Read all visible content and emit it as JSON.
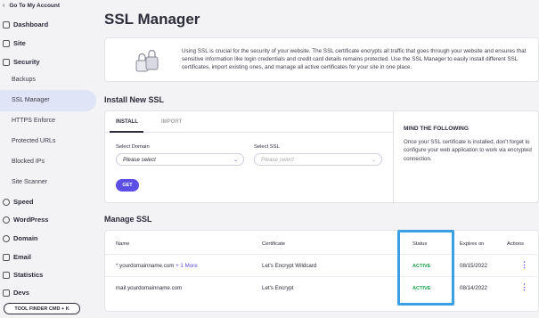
{
  "sidebar": {
    "goto": "Go To My Account",
    "items": [
      {
        "label": "Dashboard",
        "icon": "grid-icon"
      },
      {
        "label": "Site",
        "icon": "site-icon"
      },
      {
        "label": "Security",
        "icon": "lock-icon"
      },
      {
        "label": "Speed",
        "icon": "speed-icon"
      },
      {
        "label": "WordPress",
        "icon": "wordpress-icon"
      },
      {
        "label": "Domain",
        "icon": "globe-icon"
      },
      {
        "label": "Email",
        "icon": "email-icon"
      },
      {
        "label": "Statistics",
        "icon": "chart-icon"
      },
      {
        "label": "Devs",
        "icon": "code-icon"
      }
    ],
    "security_sub": [
      "Backups",
      "SSL Manager",
      "HTTPS Enforce",
      "Protected URLs",
      "Blocked IPs",
      "Site Scanner"
    ],
    "tool_finder": "TOOL FINDER CMD + K"
  },
  "page": {
    "title": "SSL Manager",
    "intro": "Using SSL is crucial for the security of your website. The SSL certificate encrypts all traffic that goes through your website and ensures that sensitive information like login credentials and credit card details remains protected. Use the SSL Manager to easily install different SSL certificates, import existing ones, and manage all active certificates for your site in one place."
  },
  "install": {
    "title": "Install New SSL",
    "tabs": [
      "INSTALL",
      "IMPORT"
    ],
    "domain_label": "Select Domain",
    "domain_value": "Please select",
    "ssl_label": "Select SSL",
    "ssl_value": "Please select",
    "get_button": "GET",
    "mind_title": "MIND THE FOLLOWING",
    "mind_text": "Once your SSL certificate is installed, don't forget to configure your web application to work via encrypted connection."
  },
  "manage": {
    "title": "Manage SSL",
    "headers": [
      "Name",
      "Certificate",
      "Status",
      "Expires on",
      "Actions"
    ],
    "rows": [
      {
        "name": "*.yourdomainname.com",
        "more": "+ 1 More",
        "certificate": "Let's Encrypt Wildcard",
        "status": "ACTIVE",
        "expires": "08/15/2022"
      },
      {
        "name": "mail.yourdomainname.com",
        "more": "",
        "certificate": "Let's Encrypt",
        "status": "ACTIVE",
        "expires": "08/14/2022"
      }
    ]
  },
  "colors": {
    "accent": "#5b4fe5",
    "active": "#1aa34a",
    "highlight": "#3b9fe6"
  }
}
